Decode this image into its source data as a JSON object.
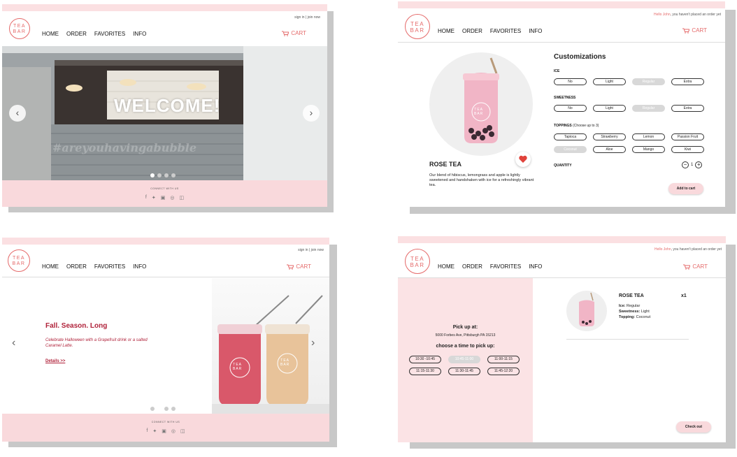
{
  "brand": {
    "line1": "TEA",
    "line2": "BAR"
  },
  "nav": [
    "HOME",
    "ORDER",
    "FAVORITES",
    "INFO"
  ],
  "cart_label": "CART",
  "auth": {
    "signin": "sign in | join now"
  },
  "greeting": {
    "name": "Hello John",
    "rest": ", you haven't placed an order yet"
  },
  "home1": {
    "hero_title": "WELCOME!",
    "truck_text": "#areyouhavingabubble",
    "slide_active": 1,
    "slide_count": 4
  },
  "footer": {
    "connect": "CONNECT WITH US",
    "social_icons": [
      "facebook-icon",
      "twitter-icon",
      "google-plus-icon",
      "pinterest-icon",
      "instagram-icon"
    ]
  },
  "home2": {
    "title": "Fall. Season. Long",
    "subtitle": "Celebrate Halloween with a Grapefruit drink or a salted Caramel Latte.",
    "link": "Details >>",
    "slide_active": 2,
    "slide_count": 4
  },
  "product": {
    "name": "ROSE TEA",
    "description": "Our blend of hibiscus, lemongrass and apple is lightly sweetened and handshaken with ice for a refreshingly vibrant tea.",
    "customizations_title": "Customizations",
    "ice_label": "ICE",
    "ice_options": [
      "No",
      "Light",
      "Regular",
      "Extra"
    ],
    "ice_selected": "Regular",
    "sweetness_label": "SWEETNESS",
    "sweetness_options": [
      "No",
      "Light",
      "Regular",
      "Extra"
    ],
    "sweetness_selected": "Regular",
    "toppings_label": "TOPPINGS",
    "toppings_hint": "(Choose up to 3)",
    "toppings": [
      "Tapioca",
      "Strawberry",
      "Lemon",
      "Passion Fruit",
      "Coconut",
      "Aloe",
      "Mango",
      "Kiwi"
    ],
    "toppings_selected": [
      "Coconut"
    ],
    "quantity_label": "QUANTITY",
    "quantity": "1",
    "add_to_cart": "Add to cart"
  },
  "checkout": {
    "pickup_title": "Pick up at:",
    "address": "5000 Forbes Ave, Pittsburgh PA 15213",
    "choose_time": "choose a time to pick up:",
    "times": [
      "10:30 -10:45",
      "10:45-11:00",
      "11:00-11:15",
      "11:15-11:30",
      "11:30-11:45",
      "11:45-12:20"
    ],
    "time_disabled": "10:45-11:00",
    "item_name": "ROSE TEA",
    "item_qty": "x1",
    "ice_label": "Ice:",
    "ice_value": "Regular",
    "sweetness_label": "Sweetness:",
    "sweetness_value": "Light",
    "topping_label": "Topping:",
    "topping_value": "Coconut",
    "checkout_button": "Check out"
  },
  "colors": {
    "accent": "#e56a6a",
    "pink": "#f9d9dc",
    "dark_red": "#b0223a"
  }
}
